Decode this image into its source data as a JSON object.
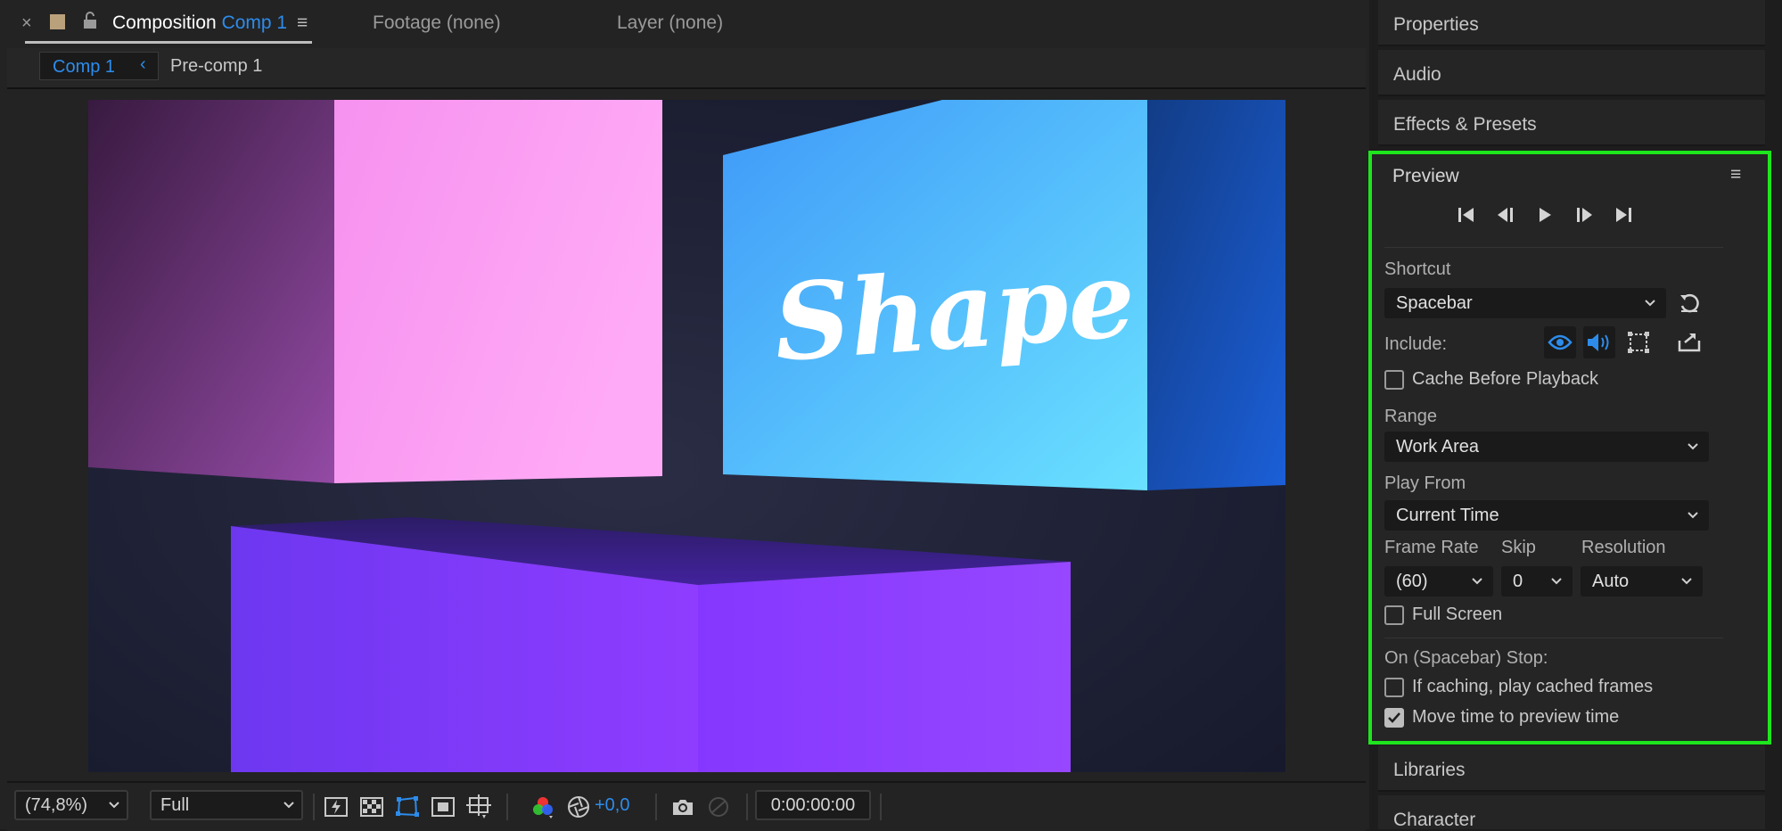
{
  "composition_tab": {
    "label": "Composition",
    "comp_name": "Comp 1"
  },
  "footage_tab": {
    "label": "Footage (none)"
  },
  "layer_tab": {
    "label": "Layer (none)"
  },
  "subtabs": {
    "active": "Comp 1",
    "other": "Pre-comp 1"
  },
  "canvas": {
    "title_text": "Shape"
  },
  "viewer_bar": {
    "zoom": "(74,8%)",
    "resolution": "Full",
    "exposure": "+0,0",
    "timecode": "0:00:00:00"
  },
  "panels": {
    "properties": "Properties",
    "audio": "Audio",
    "effects": "Effects & Presets",
    "libraries": "Libraries",
    "character": "Character"
  },
  "preview": {
    "title": "Preview",
    "shortcut_label": "Shortcut",
    "shortcut_value": "Spacebar",
    "include_label": "Include:",
    "cache_before_playback": "Cache Before Playback",
    "range_label": "Range",
    "range_value": "Work Area",
    "play_from_label": "Play From",
    "play_from_value": "Current Time",
    "frame_rate_label": "Frame Rate",
    "frame_rate_value": "(60)",
    "skip_label": "Skip",
    "skip_value": "0",
    "resolution_label": "Resolution",
    "resolution_value": "Auto",
    "full_screen": "Full Screen",
    "on_stop_label": "On (Spacebar) Stop:",
    "if_caching": "If caching, play cached frames",
    "move_time": "Move time to preview time",
    "checkboxes": {
      "cache_before_playback": false,
      "full_screen": false,
      "if_caching": false,
      "move_time": true
    }
  },
  "colors": {
    "accent": "#2d8ceb",
    "highlight_border": "#1ee51e",
    "panel": "#252525"
  }
}
